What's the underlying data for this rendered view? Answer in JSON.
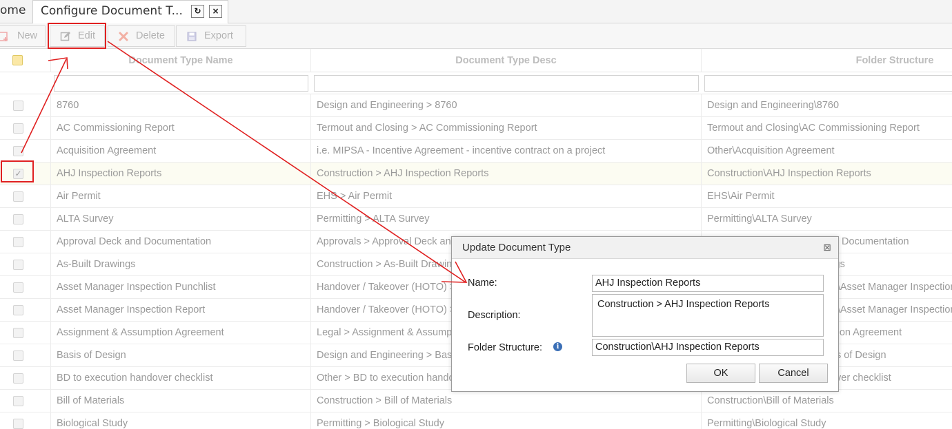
{
  "tabs": [
    {
      "label": "ome"
    },
    {
      "label": "Configure Document T..."
    }
  ],
  "tab_controls": {
    "refresh_glyph": "↻",
    "close_glyph": "×"
  },
  "toolbar": {
    "new_label": "New",
    "edit_label": "Edit",
    "delete_label": "Delete",
    "export_label": "Export"
  },
  "grid": {
    "columns": [
      "Document Type Name",
      "Document Type Desc",
      "Folder Structure"
    ],
    "rows": [
      {
        "name": "8760",
        "desc": "Design and Engineering > 8760",
        "folder": "Design and Engineering\\8760",
        "checked": false
      },
      {
        "name": "AC Commissioning Report",
        "desc": "Termout and Closing > AC Commissioning Report",
        "folder": "Termout and Closing\\AC Commissioning Report",
        "checked": false
      },
      {
        "name": "Acquisition Agreement",
        "desc": "i.e. MIPSA - Incentive Agreement - incentive contract on a project",
        "folder": "Other\\Acquisition Agreement",
        "checked": false
      },
      {
        "name": "AHJ Inspection Reports",
        "desc": "Construction > AHJ Inspection Reports",
        "folder": "Construction\\AHJ Inspection Reports",
        "checked": true
      },
      {
        "name": "Air Permit",
        "desc": "EHS > Air Permit",
        "folder": "EHS\\Air Permit",
        "checked": false
      },
      {
        "name": "ALTA Survey",
        "desc": "Permitting > ALTA Survey",
        "folder": "Permitting\\ALTA Survey",
        "checked": false
      },
      {
        "name": "Approval Deck and Documentation",
        "desc": "Approvals > Approval Deck and Documentation",
        "folder": "Approvals\\Approval Deck and Documentation",
        "checked": false
      },
      {
        "name": "As-Built Drawings",
        "desc": "Construction > As-Built Drawings",
        "folder": "Construction\\As-Built Drawings",
        "checked": false
      },
      {
        "name": "Asset Manager Inspection Punchlist",
        "desc": "Handover / Takeover (HOTO) > Asset Manager Inspection Punchlist",
        "folder": "Handover / Takeover (HOTO)\\Asset Manager Inspection Punchlist",
        "checked": false
      },
      {
        "name": "Asset Manager Inspection Report",
        "desc": "Handover / Takeover (HOTO) > Asset Manager Inspection Report",
        "folder": "Handover / Takeover (HOTO)\\Asset Manager Inspection Report",
        "checked": false
      },
      {
        "name": "Assignment & Assumption Agreement",
        "desc": "Legal > Assignment & Assumption Agreement",
        "folder": "Legal\\Assignment & Assumption Agreement",
        "checked": false
      },
      {
        "name": "Basis of Design",
        "desc": "Design and Engineering > Basis of Design",
        "folder": "Design and Engineering\\Basis of Design",
        "checked": false
      },
      {
        "name": "BD to execution handover checklist",
        "desc": "Other > BD to execution handover checklist",
        "folder": "Other\\BD to execution handover checklist",
        "checked": false
      },
      {
        "name": "Bill of Materials",
        "desc": "Construction > Bill of Materials",
        "folder": "Construction\\Bill of Materials",
        "checked": false
      },
      {
        "name": "Biological Study",
        "desc": "Permitting > Biological Study",
        "folder": "Permitting\\Biological Study",
        "checked": false
      }
    ]
  },
  "dialog": {
    "title": "Update Document Type",
    "close_glyph": "⊠",
    "name_label": "Name:",
    "name_value": "AHJ Inspection Reports",
    "description_label": "Description:",
    "description_value": "Construction > AHJ Inspection Reports",
    "folder_label": "Folder Structure:",
    "folder_info_glyph": "i",
    "folder_value": "Construction\\AHJ Inspection Reports",
    "ok_label": "OK",
    "cancel_label": "Cancel"
  },
  "colors": {
    "annotation_red": "#e02020",
    "selected_row": "#fcfcf2",
    "info_blue": "#3b6fb6"
  }
}
